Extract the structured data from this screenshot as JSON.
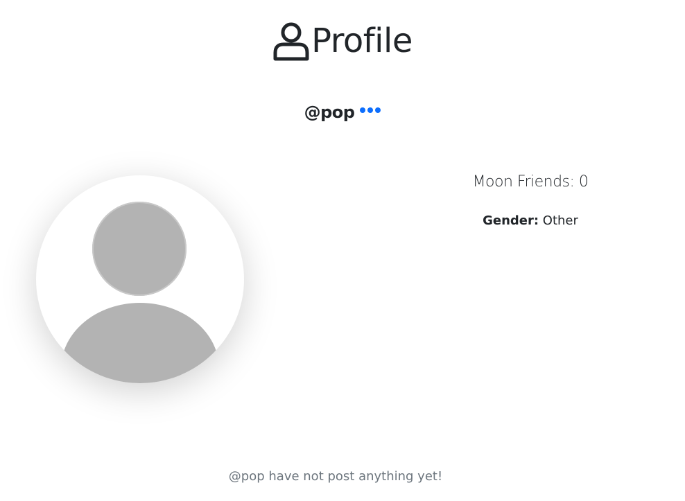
{
  "header": {
    "title": "Profile",
    "icon": "user-outline-icon"
  },
  "profile": {
    "handle": "@pop",
    "more_icon": "more-dots-icon",
    "accent_color": "#0d6efd",
    "avatar_icon": "default-avatar-icon",
    "friends_text": "Moon Friends: 0",
    "gender_label": "Gender:",
    "gender_value": "Other"
  },
  "posts": {
    "empty_message": "@pop have not post anything yet!"
  }
}
